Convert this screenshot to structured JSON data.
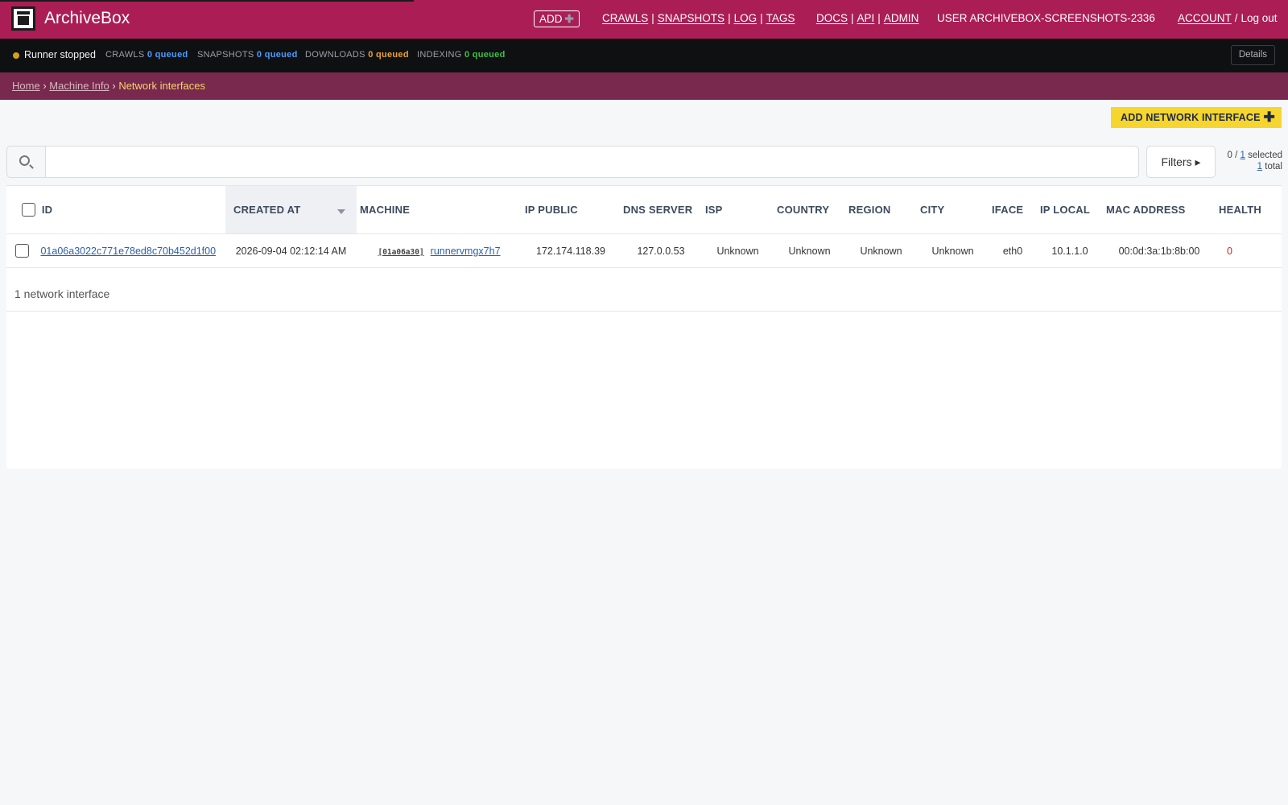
{
  "header": {
    "brand": "ArchiveBox",
    "add_label": "ADD",
    "nav_main": [
      "CRAWLS",
      "SNAPSHOTS",
      "LOG",
      "TAGS"
    ],
    "nav_docs": [
      "DOCS",
      "API",
      "ADMIN"
    ],
    "user_label": "USER ARCHIVEBOX-SCREENSHOTS-2336",
    "account_label": "ACCOUNT",
    "logout_label": "Log out"
  },
  "statusbar": {
    "runner": "Runner stopped",
    "crawls_label": "CRAWLS",
    "crawls_value": "0 queued",
    "snapshots_label": "SNAPSHOTS",
    "snapshots_value": "0 queued",
    "downloads_label": "DOWNLOADS",
    "downloads_value": "0 queued",
    "indexing_label": "INDEXING",
    "indexing_value": "0 queued",
    "details_label": "Details",
    "colors": {
      "runner_dot": "#d4a017",
      "crawls": "#4c9bff",
      "snapshots": "#4c9bff",
      "downloads": "#e8a23a",
      "indexing": "#3fbf4a"
    }
  },
  "breadcrumbs": {
    "home": "Home",
    "machine_info": "Machine Info",
    "current": "Network interfaces",
    "sep": "›"
  },
  "actions": {
    "add_network_interface": "ADD NETWORK INTERFACE",
    "filters": "Filters ▸"
  },
  "search": {
    "placeholder": "",
    "value": ""
  },
  "selection": {
    "selected": "0",
    "of": "1",
    "selected_word": "selected",
    "total": "1",
    "total_word": "total"
  },
  "table": {
    "columns": [
      "ID",
      "CREATED AT",
      "MACHINE",
      "IP PUBLIC",
      "DNS SERVER",
      "ISP",
      "COUNTRY",
      "REGION",
      "CITY",
      "IFACE",
      "IP LOCAL",
      "MAC ADDRESS",
      "HEALTH"
    ],
    "rows": [
      {
        "id": "01a06a3022c771e78ed8c70b452d1f00",
        "created_at": "2026-09-04 02:12:14 AM",
        "machine_abid": "[01a06a30]",
        "machine_name": "runnervmgx7h7",
        "ip_public": "172.174.118.39",
        "dns_server": "127.0.0.53",
        "isp": "Unknown",
        "country": "Unknown",
        "region": "Unknown",
        "city": "Unknown",
        "iface": "eth0",
        "ip_local": "10.1.1.0",
        "mac_address": "00:0d:3a:1b:8b:00",
        "health": "0"
      }
    ],
    "footer": "1 network interface"
  },
  "colors": {
    "header_bg": "#aa1e55",
    "statusbar_bg": "#0f1012",
    "crumbs_bg": "#78294d",
    "add_button_bg": "#f6d52f",
    "health_bad": "#e31b23"
  },
  "icons": {
    "search": "search-icon",
    "logo": "archivebox-logo-icon",
    "plus": "plus-icon",
    "sort": "sort-desc-icon"
  }
}
